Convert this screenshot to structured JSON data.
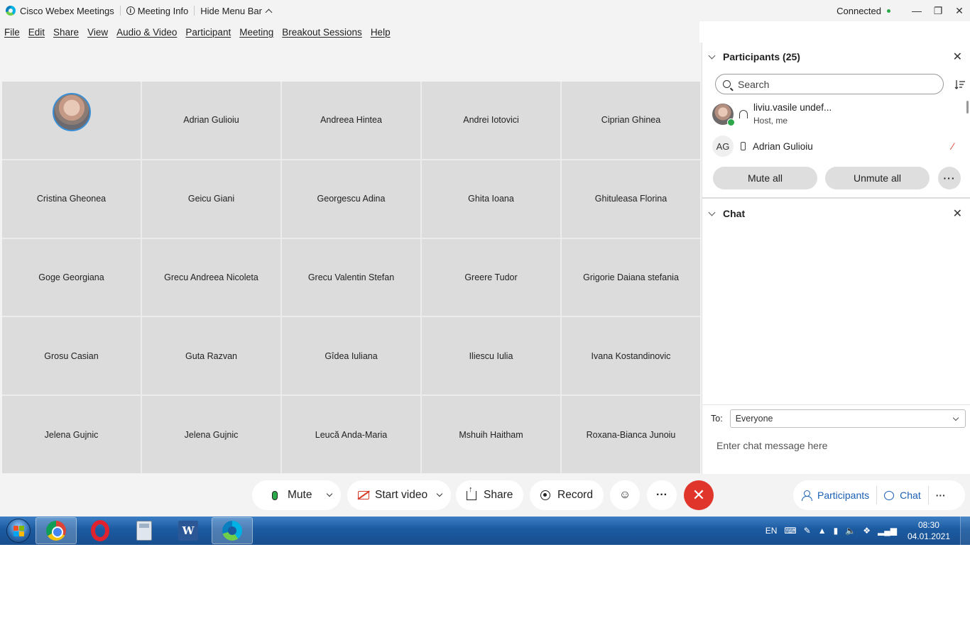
{
  "titlebar": {
    "app_name": "Cisco Webex Meetings",
    "meeting_info": "Meeting Info",
    "hide_menu": "Hide Menu Bar",
    "status": "Connected"
  },
  "menu": [
    "File",
    "Edit",
    "Share",
    "View",
    "Audio & Video",
    "Participant",
    "Meeting",
    "Breakout Sessions",
    "Help"
  ],
  "grid": {
    "tiles": [
      "",
      "Adrian Gulioiu",
      "Andreea Hintea",
      "Andrei Iotovici",
      "Ciprian Ghinea",
      "Cristina Gheonea",
      "Geicu Giani",
      "Georgescu Adina",
      "Ghita Ioana",
      "Ghituleasa Florina",
      "Goge Georgiana",
      "Grecu Andreea Nicoleta",
      "Grecu Valentin Stefan",
      "Greere Tudor",
      "Grigorie Daiana stefania",
      "Grosu Casian",
      "Guta Razvan",
      "Gîdea Iuliana",
      "Iliescu Iulia",
      "Ivana Kostandinovic",
      "Jelena Gujnic",
      "Jelena Gujnic",
      "Leucă Anda-Maria",
      "Mshuih Haitham",
      "Roxana-Bianca Junoiu"
    ]
  },
  "participants_panel": {
    "title": "Participants (25)",
    "search_placeholder": "Search",
    "host": {
      "name": "liviu.vasile undef...",
      "role": "Host, me"
    },
    "second": {
      "initials": "AG",
      "name": "Adrian Gulioiu"
    },
    "mute_all": "Mute all",
    "unmute_all": "Unmute all",
    "more": "···"
  },
  "chat_panel": {
    "title": "Chat",
    "to_label": "To:",
    "to_value": "Everyone",
    "input_placeholder": "Enter chat message here"
  },
  "controls": {
    "mute": "Mute",
    "start_video": "Start video",
    "share": "Share",
    "record": "Record",
    "more": "···",
    "end": "✕",
    "participants": "Participants",
    "chat": "Chat"
  },
  "taskbar": {
    "language": "EN",
    "time": "08:30",
    "date": "04.01.2021"
  },
  "colors": {
    "accent": "#1a5fb4",
    "end_call": "#e0352b",
    "connected": "#2aa84a",
    "taskbar": "#1c5aa0"
  }
}
